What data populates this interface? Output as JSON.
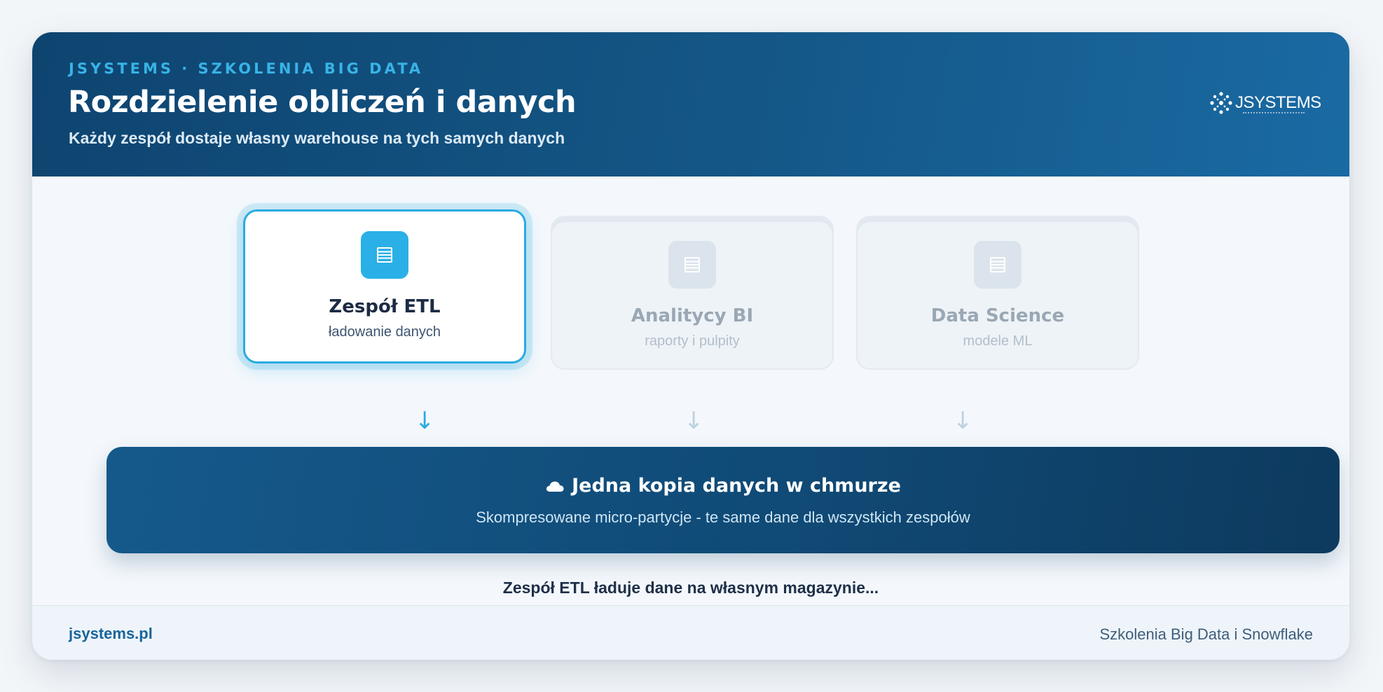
{
  "header": {
    "eyebrow": "JSYSTEMS · SZKOLENIA BIG DATA",
    "title": "Rozdzielenie obliczeń i danych",
    "subtitle": "Każdy zespół dostaje własny warehouse na tych samych danych",
    "logo_text": "JSYSTEMS"
  },
  "teams": [
    {
      "name": "Zespół ETL",
      "desc": "ładowanie danych",
      "active": true,
      "icon": "database-icon"
    },
    {
      "name": "Analitycy BI",
      "desc": "raporty i pulpity",
      "active": false,
      "icon": "database-icon"
    },
    {
      "name": "Data Science",
      "desc": "modele ML",
      "active": false,
      "icon": "database-icon"
    }
  ],
  "arrows": [
    "↓",
    "↓",
    "↓"
  ],
  "storage": {
    "icon": "cloud-icon",
    "title": "Jedna kopia danych w chmurze",
    "subtitle": "Skompresowane micro-partycje - te same dane dla wszystkich zespołów"
  },
  "caption": "Zespół ETL ładuje dane na własnym magazynie...",
  "footer": {
    "left": "jsystems.pl",
    "right": "Szkolenia Big Data i Snowflake"
  },
  "colors": {
    "accent": "#2aabe0",
    "header_dark": "#0e4470",
    "storage": "#104a76",
    "inactive": "#eef3f7"
  }
}
